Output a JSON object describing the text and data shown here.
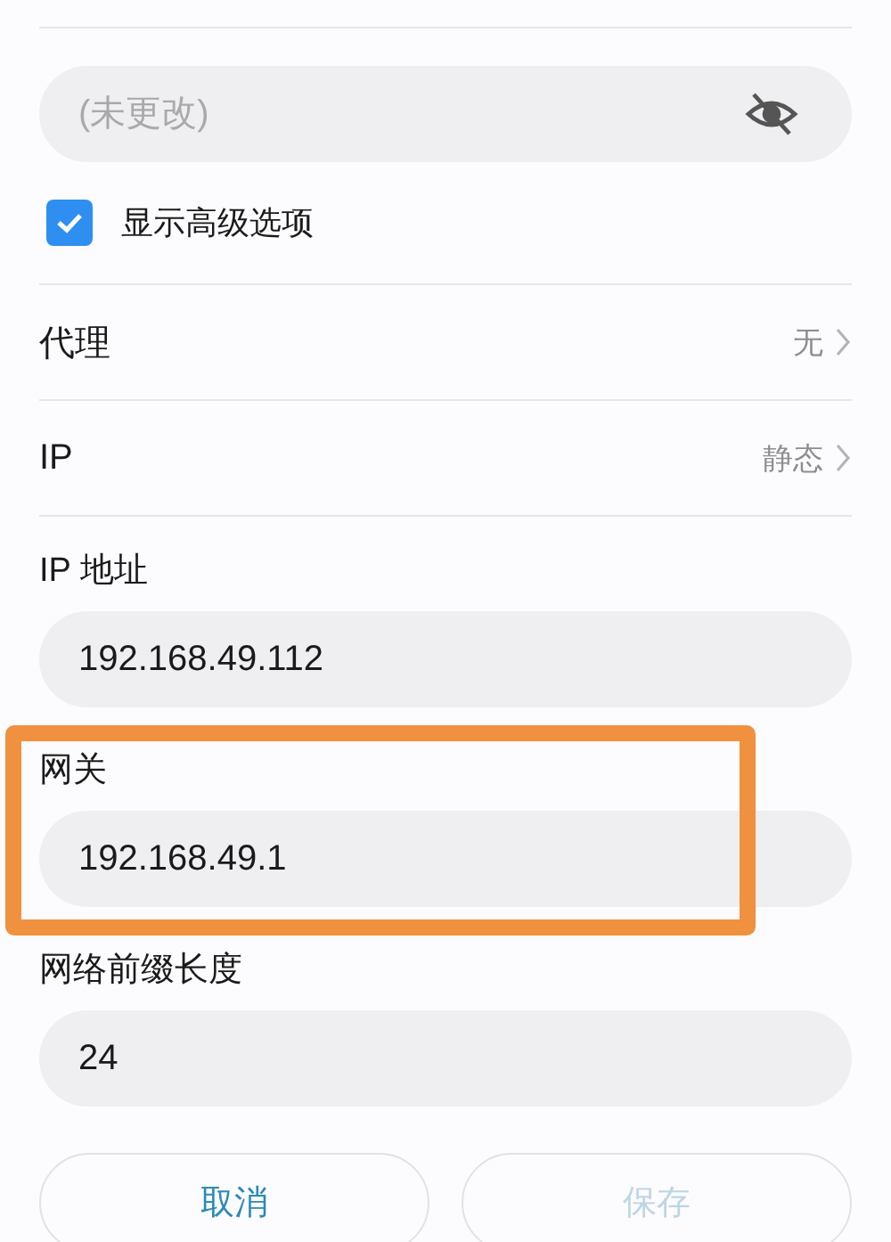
{
  "password_field": {
    "placeholder": "(未更改)",
    "password_visible": false
  },
  "advanced_options": {
    "label": "显示高级选项",
    "checked": true
  },
  "settings": [
    {
      "label": "代理",
      "value": "无"
    },
    {
      "label": "IP",
      "value": "静态"
    }
  ],
  "fields": [
    {
      "label": "IP 地址",
      "value": "192.168.49.112",
      "highlighted": false
    },
    {
      "label": "网关",
      "value": "192.168.49.1",
      "highlighted": true
    },
    {
      "label": "网络前缀长度",
      "value": "24",
      "highlighted": false
    }
  ],
  "buttons": [
    {
      "label": "取消",
      "disabled": false
    },
    {
      "label": "保存",
      "disabled": true
    }
  ]
}
